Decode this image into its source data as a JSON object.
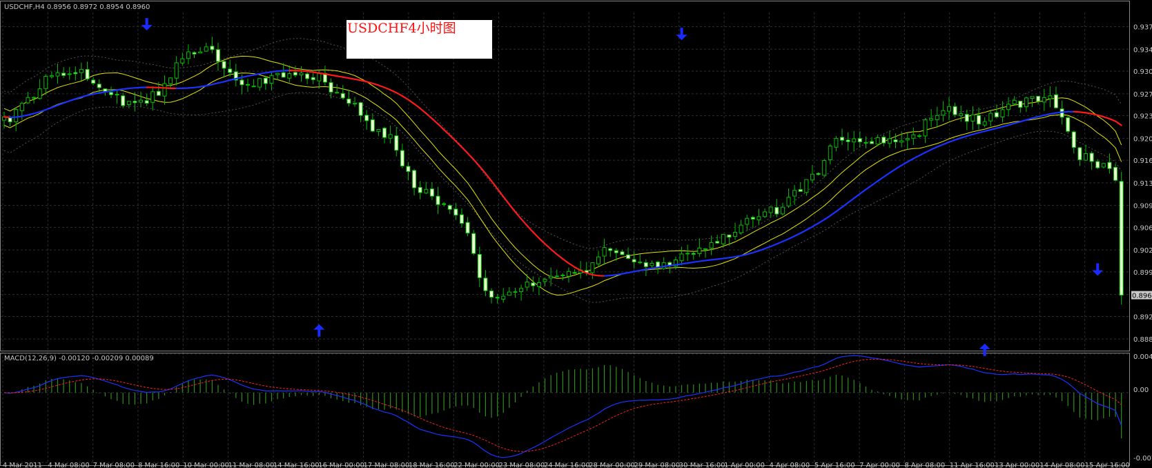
{
  "chart_header": {
    "symbol_line": "USDCHF,H4  0.8956 0.8972 0.8954 0.8960"
  },
  "annotation": {
    "text": "USDCHF4小时图"
  },
  "macd_panel": {
    "label": "MACD(12,26,9) -0.00120 -0.00209 0.00089",
    "y_ticks": [
      "0.0042",
      "0.00",
      "-0.0076"
    ]
  },
  "chart_data": [
    {
      "type": "candlestick",
      "panel": "price",
      "ylim": [
        0.8874,
        0.9398
      ],
      "y_ticks": [
        0.9376,
        0.9341,
        0.9307,
        0.9272,
        0.9238,
        0.9203,
        0.9169,
        0.9134,
        0.9099,
        0.9065,
        0.903,
        0.8996,
        0.8961,
        0.8927,
        0.8892
      ],
      "y_tick_labels": [
        "0.937",
        "0.934",
        "0.930",
        "0.927",
        "0.923",
        "0.920",
        "0.916",
        "0.913",
        "0.909",
        "0.906",
        "0.902",
        "0.899",
        "0.896",
        "0.892",
        "0.888"
      ],
      "current_price": 0.896,
      "current_price_label": "0.8960",
      "x_labels": [
        "4 Mar 2011",
        "4 Mar 08:00",
        "7 Mar 08:00",
        "8 Mar 16:00",
        "10 Mar 00:00",
        "11 Mar 08:00",
        "14 Mar 16:00",
        "16 Mar 00:00",
        "17 Mar 08:00",
        "18 Mar 16:00",
        "22 Mar 00:00",
        "23 Mar 08:00",
        "24 Mar 16:00",
        "28 Mar 00:00",
        "29 Mar 08:00",
        "30 Mar 16:00",
        "1 Apr 00:00",
        "4 Apr 08:00",
        "5 Apr 16:00",
        "7 Apr 00:00",
        "8 Apr 08:00",
        "11 Apr 16:00",
        "13 Apr 00:00",
        "14 Apr 08:00",
        "15 Apr 16:00"
      ],
      "candle_count": 189,
      "anchor_closes": [
        [
          0,
          0.923
        ],
        [
          4,
          0.9262
        ],
        [
          8,
          0.9302
        ],
        [
          12,
          0.9311
        ],
        [
          16,
          0.9279
        ],
        [
          22,
          0.9254
        ],
        [
          26,
          0.9272
        ],
        [
          30,
          0.9334
        ],
        [
          34,
          0.9343
        ],
        [
          40,
          0.9288
        ],
        [
          46,
          0.9297
        ],
        [
          52,
          0.9299
        ],
        [
          58,
          0.9258
        ],
        [
          64,
          0.9208
        ],
        [
          70,
          0.9124
        ],
        [
          76,
          0.9088
        ],
        [
          82,
          0.8952
        ],
        [
          86,
          0.8971
        ],
        [
          92,
          0.8993
        ],
        [
          96,
          0.8993
        ],
        [
          102,
          0.9029
        ],
        [
          110,
          0.9005
        ],
        [
          118,
          0.9034
        ],
        [
          126,
          0.9073
        ],
        [
          130,
          0.9093
        ],
        [
          136,
          0.9141
        ],
        [
          140,
          0.9208
        ],
        [
          146,
          0.9199
        ],
        [
          152,
          0.9203
        ],
        [
          158,
          0.9248
        ],
        [
          164,
          0.9231
        ],
        [
          170,
          0.9257
        ],
        [
          176,
          0.9264
        ],
        [
          181,
          0.9177
        ],
        [
          188,
          0.9143
        ],
        [
          196,
          0.9066
        ],
        [
          204,
          0.9023
        ],
        [
          210,
          0.895
        ],
        [
          216,
          0.8928
        ],
        [
          222,
          0.8939
        ],
        [
          228,
          0.8965
        ],
        [
          232,
          0.896
        ]
      ],
      "signal_arrows": [
        {
          "direction": "down",
          "price": 0.937,
          "label_time": "8 Mar 16:00"
        },
        {
          "direction": "up",
          "price": 0.8915,
          "label_time": "16 Mar 00:00"
        },
        {
          "direction": "down",
          "price": 0.9355,
          "label_time": "1 Apr 00:00"
        },
        {
          "direction": "up",
          "price": 0.8885,
          "label_time": "13 Apr 00:00"
        },
        {
          "direction": "down",
          "price": 0.899,
          "label_time": "15 Apr 16:00"
        }
      ],
      "colors": {
        "background": "#000000",
        "grid": "#2a2f33",
        "candle_bull_body": "#000000",
        "candle_bear_body": "#e6ffcc",
        "candle_wick": "#00c000",
        "ma_up": "#1a33ff",
        "ma_down": "#ff1a1a",
        "bands": "#e6e600",
        "envelope": "#555555",
        "arrow": "#1a2bff"
      }
    },
    {
      "type": "macd",
      "panel": "macd",
      "params": [
        12,
        26,
        9
      ],
      "ylim": [
        -0.0076,
        0.0042
      ],
      "last_values": {
        "main": -0.0012,
        "signal": -0.00209,
        "histogram": 0.00089
      },
      "colors": {
        "main": "#1a33ff",
        "signal": "#ff2020",
        "histogram": "#2f8f1a"
      }
    }
  ]
}
